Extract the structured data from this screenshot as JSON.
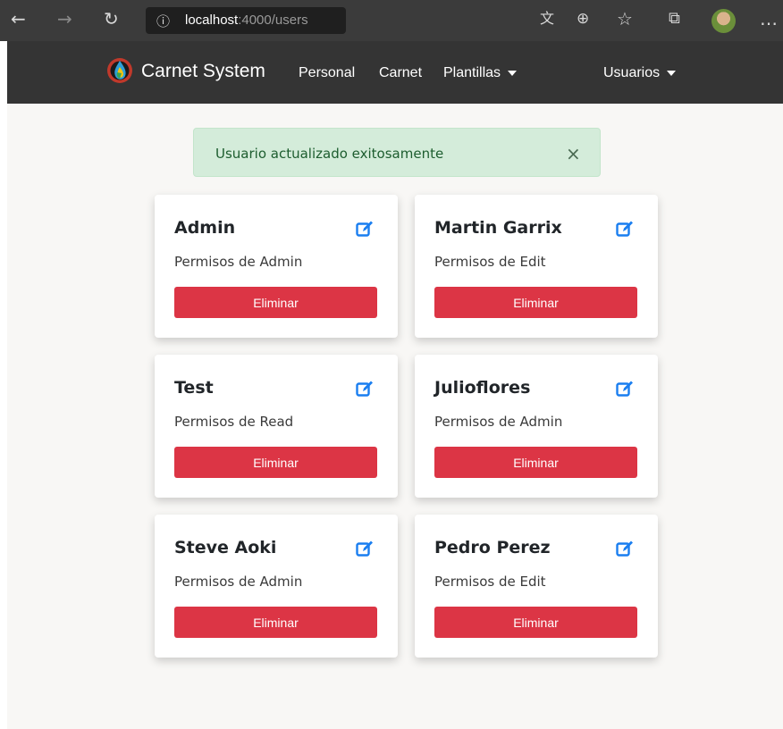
{
  "browser": {
    "info_icon": "ⓘ",
    "url_host": "localhost",
    "url_path": ":4000/users",
    "icons": [
      "back-arrow-icon",
      "forward-arrow-icon",
      "refresh-icon",
      "info-icon",
      "translate-icon",
      "zoom-icon",
      "favorite-star-icon",
      "collections-icon",
      "profile-avatar-icon",
      "more-menu-icon"
    ]
  },
  "navbar": {
    "brand": "Carnet System",
    "links": [
      "Personal",
      "Carnet",
      "Plantillas",
      "Usuarios"
    ]
  },
  "alert": {
    "message": "Usuario actualizado exitosamente",
    "close": "×"
  },
  "users": [
    {
      "name": "Admin",
      "permission": "Permisos de Admin",
      "delete_label": "Eliminar"
    },
    {
      "name": "Martin Garrix",
      "permission": "Permisos de Edit",
      "delete_label": "Eliminar"
    },
    {
      "name": "Test",
      "permission": "Permisos de Read",
      "delete_label": "Eliminar"
    },
    {
      "name": "Julioflores",
      "permission": "Permisos de Admin",
      "delete_label": "Eliminar"
    },
    {
      "name": "Steve Aoki",
      "permission": "Permisos de Admin",
      "delete_label": "Eliminar"
    },
    {
      "name": "Pedro Perez",
      "permission": "Permisos de Edit",
      "delete_label": "Eliminar"
    }
  ],
  "colors": {
    "navbar": "#343434",
    "danger": "#dc3545",
    "edit_icon": "#1a7ef0",
    "alert_bg": "#d4ecda"
  }
}
